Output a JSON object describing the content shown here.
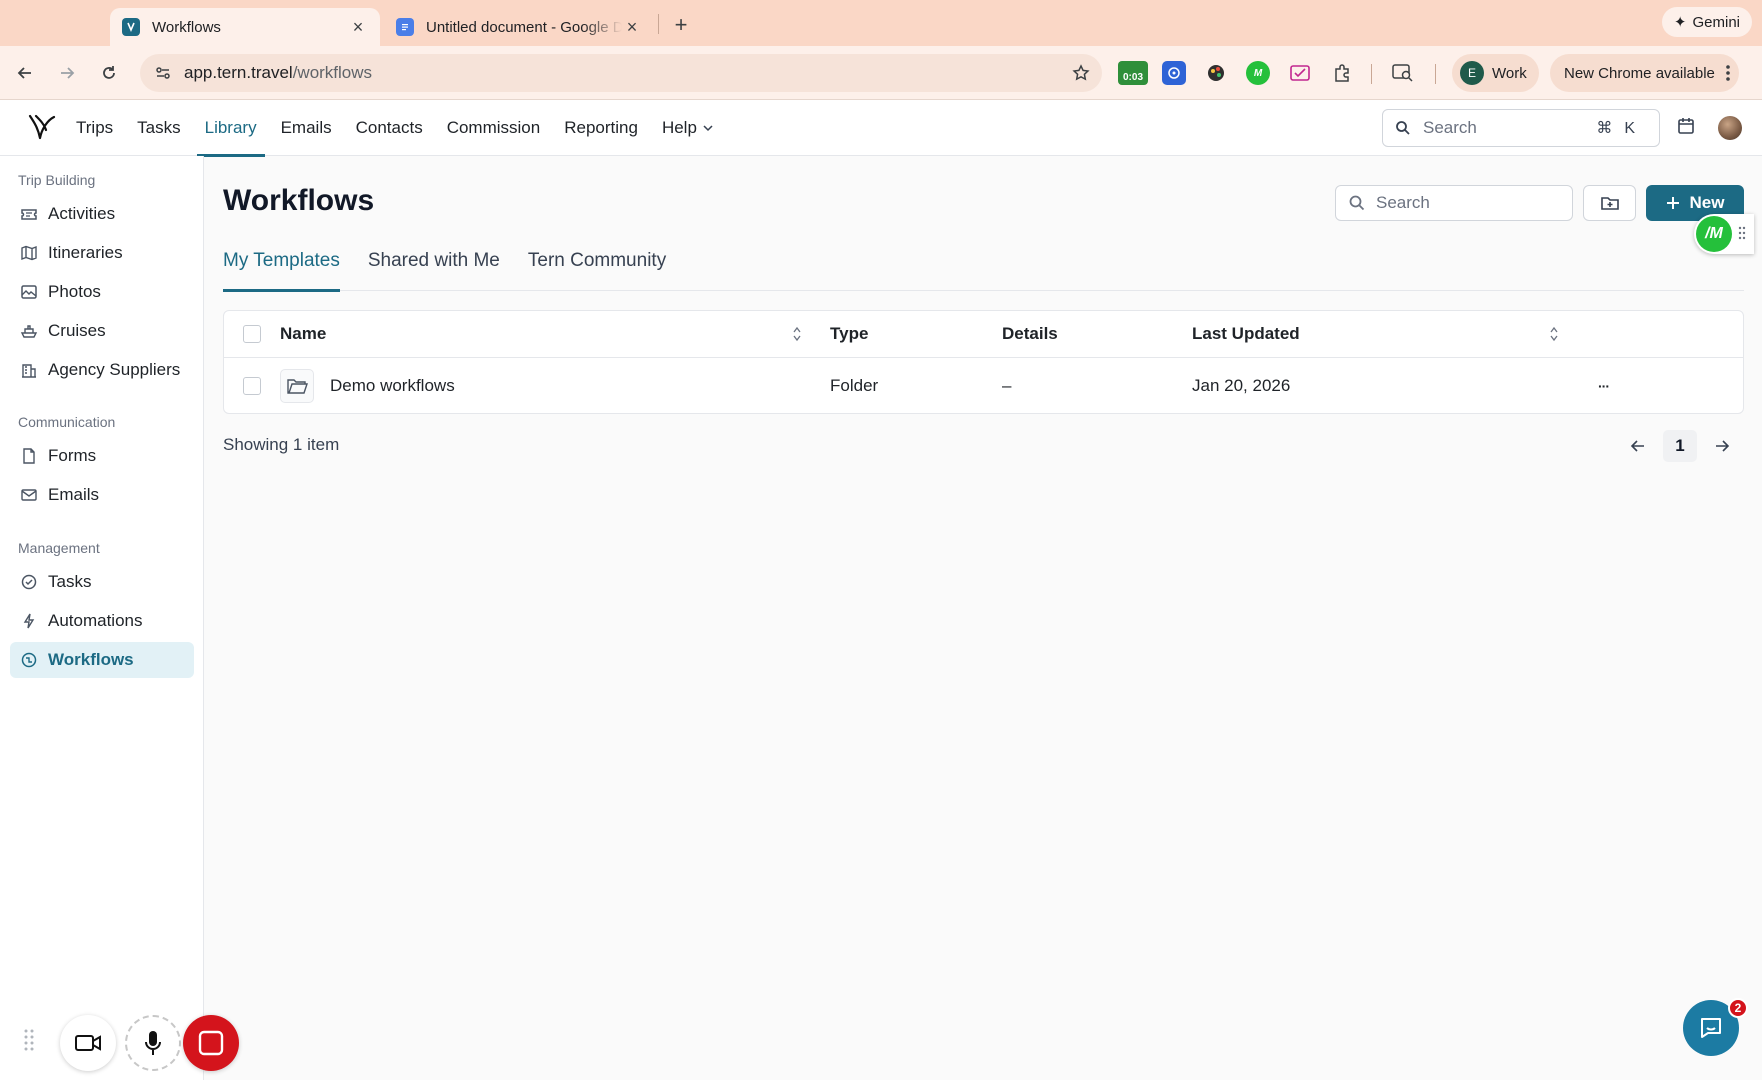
{
  "browser": {
    "tabs": [
      {
        "title": "Workflows",
        "active": true
      },
      {
        "title": "Untitled document - Google Docs",
        "active": false
      }
    ],
    "gemini_label": "Gemini",
    "url_host": "app.tern.travel",
    "url_path": "/workflows",
    "timer_badge": "0:03",
    "profile_initial": "E",
    "profile_label": "Work",
    "update_label": "New Chrome available",
    "tab_bg_color": "#fad7c6"
  },
  "header": {
    "nav": [
      {
        "label": "Trips",
        "active": false
      },
      {
        "label": "Tasks",
        "active": false
      },
      {
        "label": "Library",
        "active": true
      },
      {
        "label": "Emails",
        "active": false
      },
      {
        "label": "Contacts",
        "active": false
      },
      {
        "label": "Commission",
        "active": false
      },
      {
        "label": "Reporting",
        "active": false
      },
      {
        "label": "Help",
        "active": false,
        "has_dropdown": true
      }
    ],
    "search_placeholder": "Search",
    "search_shortcut": "⌘K",
    "accent_color": "#1c6a84"
  },
  "sidebar": {
    "sections": [
      {
        "title": "Trip Building",
        "items": [
          {
            "label": "Activities",
            "icon": "ticket-icon"
          },
          {
            "label": "Itineraries",
            "icon": "map-icon"
          },
          {
            "label": "Photos",
            "icon": "image-icon"
          },
          {
            "label": "Cruises",
            "icon": "ship-icon"
          },
          {
            "label": "Agency Suppliers",
            "icon": "building-icon"
          }
        ]
      },
      {
        "title": "Communication",
        "items": [
          {
            "label": "Forms",
            "icon": "document-icon"
          },
          {
            "label": "Emails",
            "icon": "mail-icon"
          }
        ]
      },
      {
        "title": "Management",
        "items": [
          {
            "label": "Tasks",
            "icon": "check-circle-icon"
          },
          {
            "label": "Automations",
            "icon": "bolt-icon"
          },
          {
            "label": "Workflows",
            "icon": "workflow-icon",
            "active": true
          }
        ]
      }
    ]
  },
  "main": {
    "title": "Workflows",
    "search_placeholder": "Search",
    "new_button_label": "New",
    "tabs": [
      {
        "label": "My Templates",
        "active": true
      },
      {
        "label": "Shared with Me",
        "active": false
      },
      {
        "label": "Tern Community",
        "active": false
      }
    ],
    "table": {
      "columns": [
        "Name",
        "Type",
        "Details",
        "Last Updated"
      ],
      "rows": [
        {
          "name": "Demo workflows",
          "type": "Folder",
          "details": "–",
          "last_updated": "Jan 20, 2026",
          "actions": "···"
        }
      ]
    },
    "showing_text": "Showing 1 item",
    "current_page": "1"
  },
  "widgets": {
    "chat_badge_count": "2",
    "recorder_stop_color": "#d4141c"
  }
}
